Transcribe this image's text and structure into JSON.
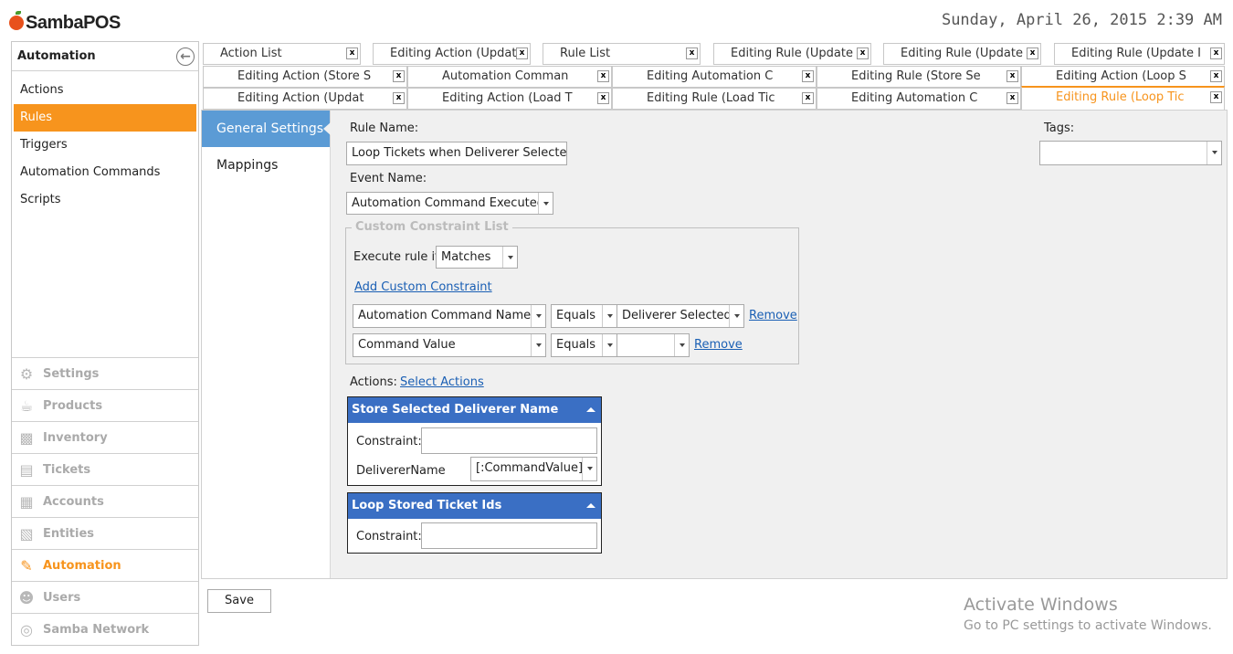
{
  "header": {
    "brand": "SambaPOS",
    "datetime": "Sunday, April 26, 2015 2:39 AM"
  },
  "sidebar": {
    "title": "Automation",
    "items": [
      {
        "label": "Actions"
      },
      {
        "label": "Rules",
        "active": true
      },
      {
        "label": "Triggers"
      },
      {
        "label": "Automation Commands"
      },
      {
        "label": "Scripts"
      }
    ],
    "modules": [
      {
        "label": "Settings",
        "icon": "gear-icon"
      },
      {
        "label": "Products",
        "icon": "cup-icon"
      },
      {
        "label": "Inventory",
        "icon": "inventory-icon"
      },
      {
        "label": "Tickets",
        "icon": "tickets-icon"
      },
      {
        "label": "Accounts",
        "icon": "calculator-icon"
      },
      {
        "label": "Entities",
        "icon": "entities-icon"
      },
      {
        "label": "Automation",
        "icon": "pencil-icon",
        "active": true
      },
      {
        "label": "Users",
        "icon": "users-icon"
      },
      {
        "label": "Samba Network",
        "icon": "globe-icon"
      }
    ]
  },
  "tabs": [
    [
      "Action List",
      "Editing Action (Update",
      "Rule List",
      "Editing Rule (Update I",
      "Editing Rule (Update I",
      "Editing Rule (Update I"
    ],
    [
      "Editing Action (Store S",
      "Automation Comman",
      "Editing Automation C",
      "Editing Rule (Store Se",
      "Editing Action (Loop S"
    ],
    [
      "Editing Action (Updat",
      "Editing Action (Load T",
      "Editing Rule (Load Tic",
      "Editing Automation C",
      "Editing Rule (Loop Tic"
    ]
  ],
  "tab_close_label": "x",
  "subnav": {
    "general": "General Settings",
    "mappings": "Mappings"
  },
  "form": {
    "rule_name_label": "Rule Name:",
    "rule_name_value": "Loop Tickets when Deliverer Selected",
    "event_name_label": "Event Name:",
    "event_name_value": "Automation Command Executed",
    "tags_label": "Tags:",
    "tags_value": "",
    "constraint_group_title": "Custom Constraint List",
    "execute_rule_if_label": "Execute rule if",
    "execute_rule_if_value": "Matches",
    "add_constraint_link": "Add Custom Constraint",
    "constraints": [
      {
        "field": "Automation Command Name",
        "op": "Equals",
        "value": "Deliverer Selected",
        "remove": "Remove"
      },
      {
        "field": "Command Value",
        "op": "Equals",
        "value": "",
        "remove": "Remove"
      }
    ],
    "actions_label": "Actions:",
    "select_actions_link": "Select Actions",
    "actions": [
      {
        "title": "Store Selected Deliverer Name",
        "constraint_label": "Constraint:",
        "constraint_value": "",
        "param_label": "DelivererName",
        "param_value": "[:CommandValue]"
      },
      {
        "title": "Loop Stored Ticket Ids",
        "constraint_label": "Constraint:",
        "constraint_value": ""
      }
    ]
  },
  "footer": {
    "save": "Save"
  },
  "watermark": {
    "line1": "Activate Windows",
    "line2": "Go to PC settings to activate Windows."
  },
  "colors": {
    "accent_orange": "#f7941d",
    "action_header_blue": "#3a6fc4",
    "subnav_active_blue": "#5b9bd5"
  }
}
